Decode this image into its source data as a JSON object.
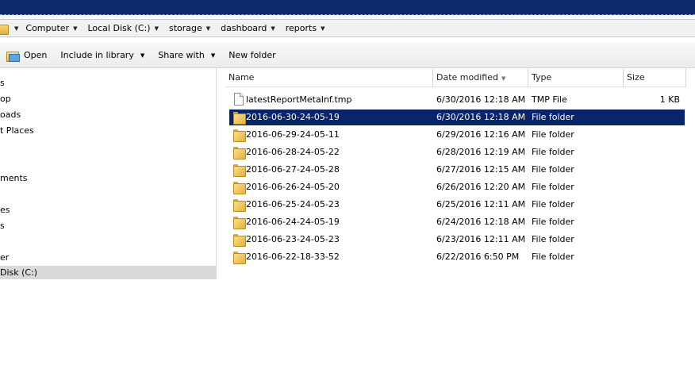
{
  "breadcrumb": [
    "Computer",
    "Local Disk (C:)",
    "storage",
    "dashboard",
    "reports"
  ],
  "toolbar": {
    "open_label": "Open",
    "include_label": "Include in library",
    "share_label": "Share with",
    "newfolder_label": "New folder"
  },
  "nav_items": [
    "s",
    "op",
    "oads",
    "t Places",
    "ments",
    "es",
    "s",
    "er",
    "Disk (C:)"
  ],
  "columns": {
    "name": "Name",
    "date": "Date modified",
    "type": "Type",
    "size": "Size"
  },
  "files": [
    {
      "name": "latestReportMetaInf.tmp",
      "date": "6/30/2016 12:18 AM",
      "type": "TMP File",
      "size": "1 KB",
      "icon": "file-icon"
    },
    {
      "name": "2016-06-30-24-05-19",
      "date": "6/30/2016 12:18 AM",
      "type": "File folder",
      "size": "",
      "icon": "folder-icon",
      "selected": true
    },
    {
      "name": "2016-06-29-24-05-11",
      "date": "6/29/2016 12:16 AM",
      "type": "File folder",
      "size": "",
      "icon": "folder-icon"
    },
    {
      "name": "2016-06-28-24-05-22",
      "date": "6/28/2016 12:19 AM",
      "type": "File folder",
      "size": "",
      "icon": "folder-icon"
    },
    {
      "name": "2016-06-27-24-05-28",
      "date": "6/27/2016 12:15 AM",
      "type": "File folder",
      "size": "",
      "icon": "folder-icon"
    },
    {
      "name": "2016-06-26-24-05-20",
      "date": "6/26/2016 12:20 AM",
      "type": "File folder",
      "size": "",
      "icon": "folder-icon"
    },
    {
      "name": "2016-06-25-24-05-23",
      "date": "6/25/2016 12:11 AM",
      "type": "File folder",
      "size": "",
      "icon": "folder-icon"
    },
    {
      "name": "2016-06-24-24-05-19",
      "date": "6/24/2016 12:18 AM",
      "type": "File folder",
      "size": "",
      "icon": "folder-icon"
    },
    {
      "name": "2016-06-23-24-05-23",
      "date": "6/23/2016 12:11 AM",
      "type": "File folder",
      "size": "",
      "icon": "folder-icon"
    },
    {
      "name": "2016-06-22-18-33-52",
      "date": "6/22/2016 6:50 PM",
      "type": "File folder",
      "size": "",
      "icon": "folder-icon"
    }
  ],
  "colors": {
    "titlebar": "#0b2a6b",
    "selection": "#0a246a",
    "nav_selected": "#d9d9d9"
  }
}
